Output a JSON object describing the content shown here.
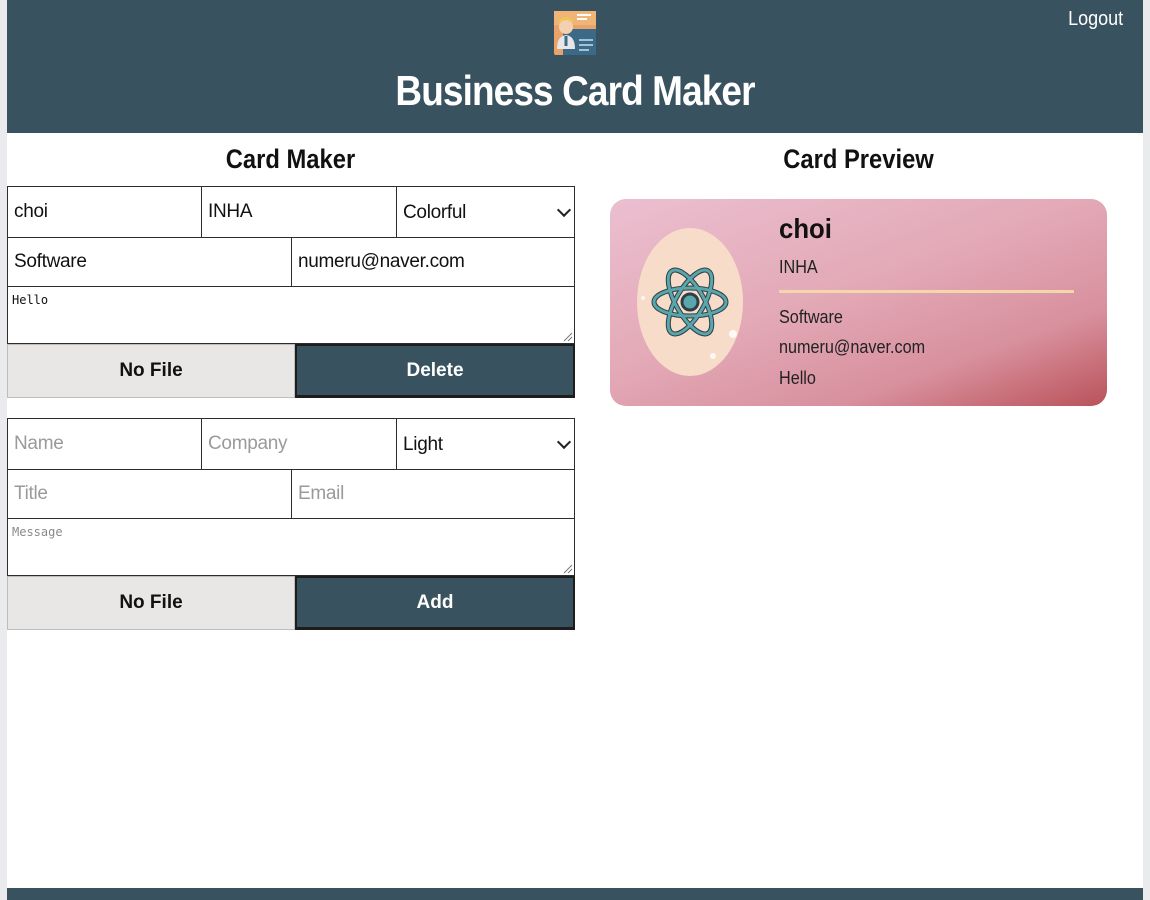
{
  "header": {
    "title": "Business Card Maker",
    "logout_label": "Logout",
    "logo_icon": "business-card-logo-icon",
    "background": "#39525f"
  },
  "maker": {
    "title": "Card Maker",
    "cards": [
      {
        "name": "choi",
        "company": "INHA",
        "theme": "Colorful",
        "title": "Software",
        "email": "numeru@naver.com",
        "message": "Hello",
        "file_label": "No File",
        "action_label": "Delete"
      }
    ],
    "add_form": {
      "name_placeholder": "Name",
      "company_placeholder": "Company",
      "theme": "Light",
      "title_placeholder": "Title",
      "email_placeholder": "Email",
      "message_placeholder": "Message",
      "file_label": "No File",
      "action_label": "Add"
    }
  },
  "preview": {
    "title": "Card Preview",
    "card": {
      "name": "choi",
      "company": "INHA",
      "title": "Software",
      "email": "numeru@naver.com",
      "message": "Hello",
      "avatar_icon": "react-atom-icon",
      "theme": "Colorful"
    }
  },
  "colors": {
    "accent": "#39525f",
    "card_gradient_start": "#ebbfd0",
    "card_gradient_end": "#b9525a",
    "divider": "#f3d7aa",
    "avatar_bg": "#f7dcc9",
    "atom": "#5aa6ad"
  }
}
